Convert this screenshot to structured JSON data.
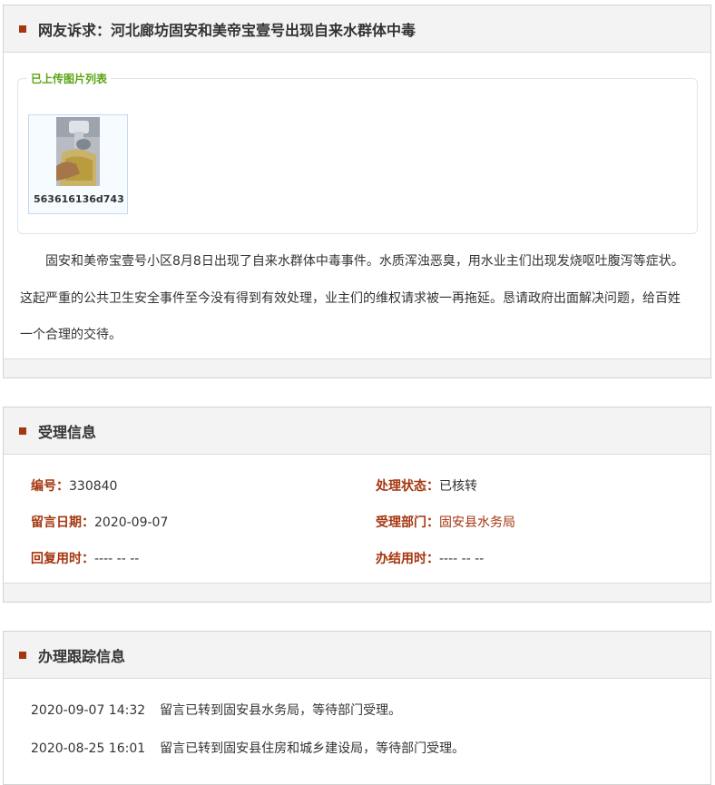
{
  "complaint": {
    "title": "网友诉求：河北廊坊固安和美帝宝壹号出现自来水群体中毒",
    "images_legend": "已上传图片列表",
    "images": [
      {
        "filename": "563616136d743",
        "icon": "photo-thumbnail"
      }
    ],
    "body": "固安和美帝宝壹号小区8月8日出现了自来水群体中毒事件。水质浑浊恶臭，用水业主们出现发烧呕吐腹泻等症状。这起严重的公共卫生安全事件至今没有得到有效处理，业主们的维权请求被一再拖延。恳请政府出面解决问题，给百姓一个合理的交待。"
  },
  "acceptance": {
    "title": "受理信息",
    "number_label": "编号：",
    "number_value": "330840",
    "status_label": "处理状态：",
    "status_value": "已核转",
    "date_label": "留言日期：",
    "date_value": "2020-09-07",
    "dept_label": "受理部门：",
    "dept_value": "固安县水务局",
    "reply_label": "回复用时：",
    "reply_value": "---- -- --",
    "finish_label": "办结用时：",
    "finish_value": "---- -- --"
  },
  "tracking": {
    "title": "办理跟踪信息",
    "entries": [
      {
        "time": "2020-09-07 14:32",
        "text": "留言已转到固安县水务局，等待部门受理。"
      },
      {
        "time": "2020-08-25 16:01",
        "text": "留言已转到固安县住房和城乡建设局，等待部门受理。"
      }
    ]
  },
  "colors": {
    "accent": "#a5360f",
    "legend": "#5aa414",
    "header_bg": "#f3f3f3"
  }
}
